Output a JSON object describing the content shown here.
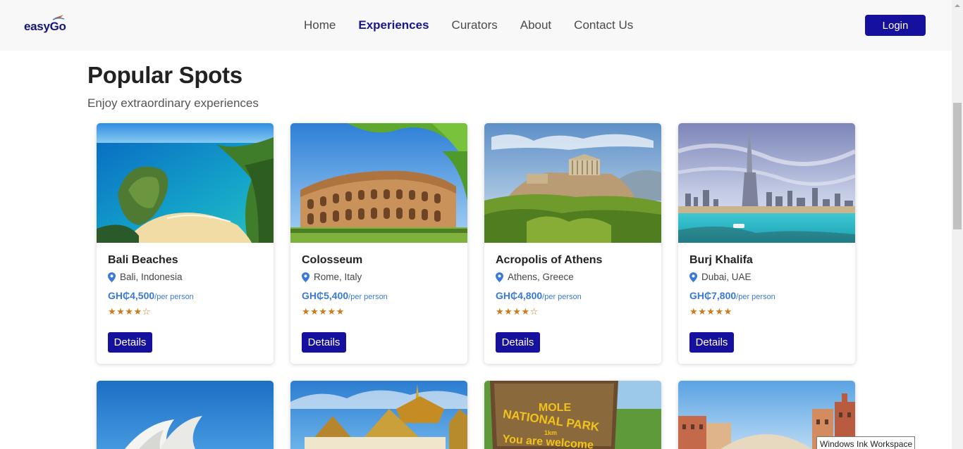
{
  "brand": {
    "name": "easyGo"
  },
  "nav": {
    "items": [
      {
        "label": "Home",
        "active": false
      },
      {
        "label": "Experiences",
        "active": true
      },
      {
        "label": "Curators",
        "active": false
      },
      {
        "label": "About",
        "active": false
      },
      {
        "label": "Contact Us",
        "active": false
      }
    ],
    "login_label": "Login"
  },
  "heading": {
    "title": "Popular Spots",
    "subtitle": "Enjoy extraordinary experiences"
  },
  "cards": [
    {
      "name": "Bali Beaches",
      "location": "Bali, Indonesia",
      "price": "GH₵4,500",
      "price_unit": "/per person",
      "rating": 4,
      "stars": "★★★★☆",
      "button": "Details"
    },
    {
      "name": "Colosseum",
      "location": "Rome, Italy",
      "price": "GH₵5,400",
      "price_unit": "/per person",
      "rating": 5,
      "stars": "★★★★★",
      "button": "Details"
    },
    {
      "name": "Acropolis of Athens",
      "location": "Athens, Greece",
      "price": "GH₵4,800",
      "price_unit": "/per person",
      "rating": 4,
      "stars": "★★★★☆",
      "button": "Details"
    },
    {
      "name": "Burj Khalifa",
      "location": "Dubai, UAE",
      "price": "GH₵7,800",
      "price_unit": "/per person",
      "rating": 5,
      "stars": "★★★★★",
      "button": "Details"
    }
  ],
  "lower_cards": {
    "park_sign_lines": [
      "MOLE",
      "NATIONAL PARK",
      "You are welcome"
    ],
    "park_sign_arrow": "1km"
  },
  "tooltip": "Windows Ink Workspace",
  "colors": {
    "primary": "#15119e",
    "brand_text": "#16137a",
    "price": "#3a79d6",
    "stars": "#d07a17",
    "header_bg": "#f8f8f8"
  },
  "icons": {
    "location": "map-pin-icon",
    "brand": "plane-icon"
  }
}
